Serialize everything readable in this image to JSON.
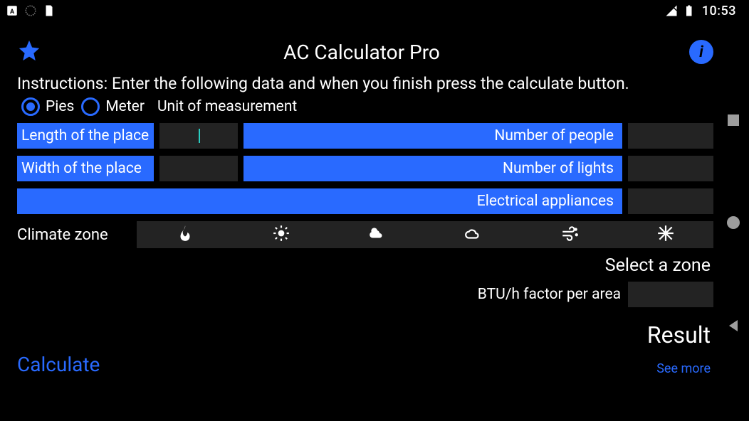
{
  "status": {
    "clock": "10:53"
  },
  "header": {
    "title": "AC Calculator Pro"
  },
  "instructions": "Instructions: Enter the following data and when you finish press the calculate button.",
  "units": {
    "option1": "Pies",
    "option2": "Meter",
    "caption": "Unit of measurement",
    "selected": "Pies"
  },
  "labels": {
    "length": "Length of the place",
    "width": "Width of the place",
    "people": "Number of people",
    "lights": "Number of lights",
    "appliances": "Electrical appliances",
    "climate": "Climate zone",
    "selectZone": "Select a zone",
    "btu": "BTU/h factor per area",
    "result": "Result",
    "calculate": "Calculate",
    "seeMore": "See more"
  }
}
